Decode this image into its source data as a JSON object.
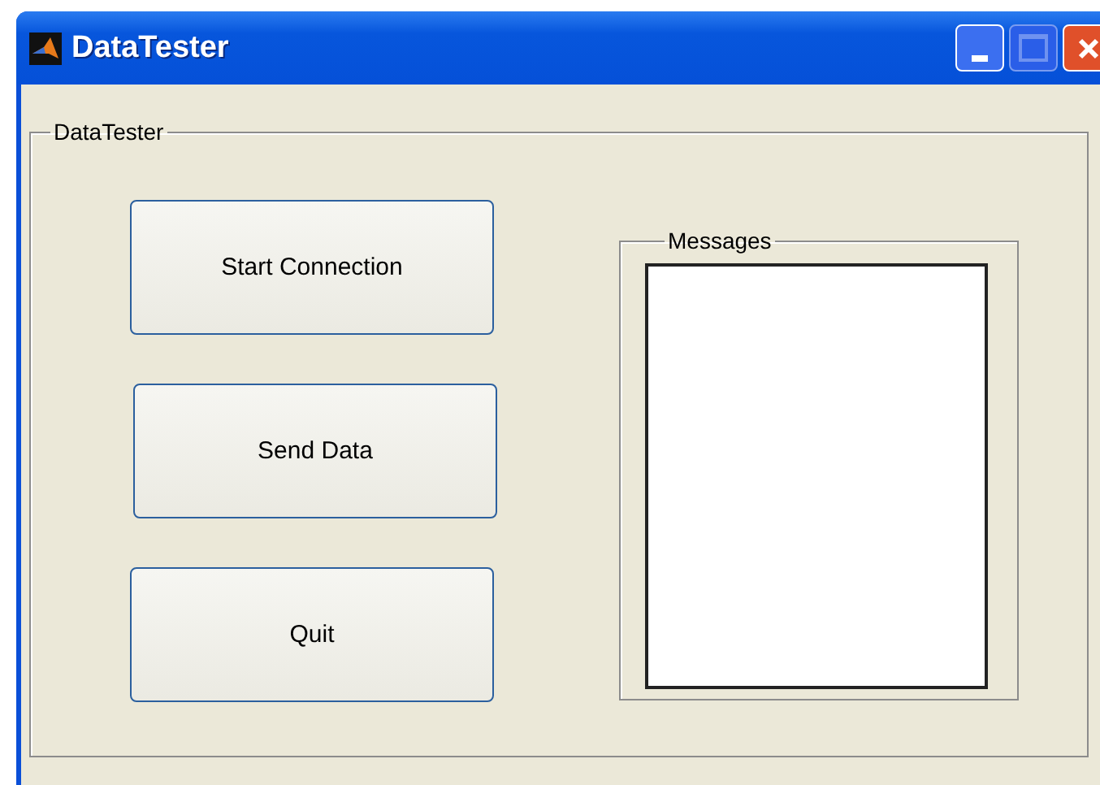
{
  "window": {
    "title": "DataTester"
  },
  "panel": {
    "title": "DataTester"
  },
  "buttons": [
    {
      "label": "Start Connection"
    },
    {
      "label": "Send Data"
    },
    {
      "label": "Quit"
    }
  ],
  "messages": {
    "title": "Messages"
  }
}
